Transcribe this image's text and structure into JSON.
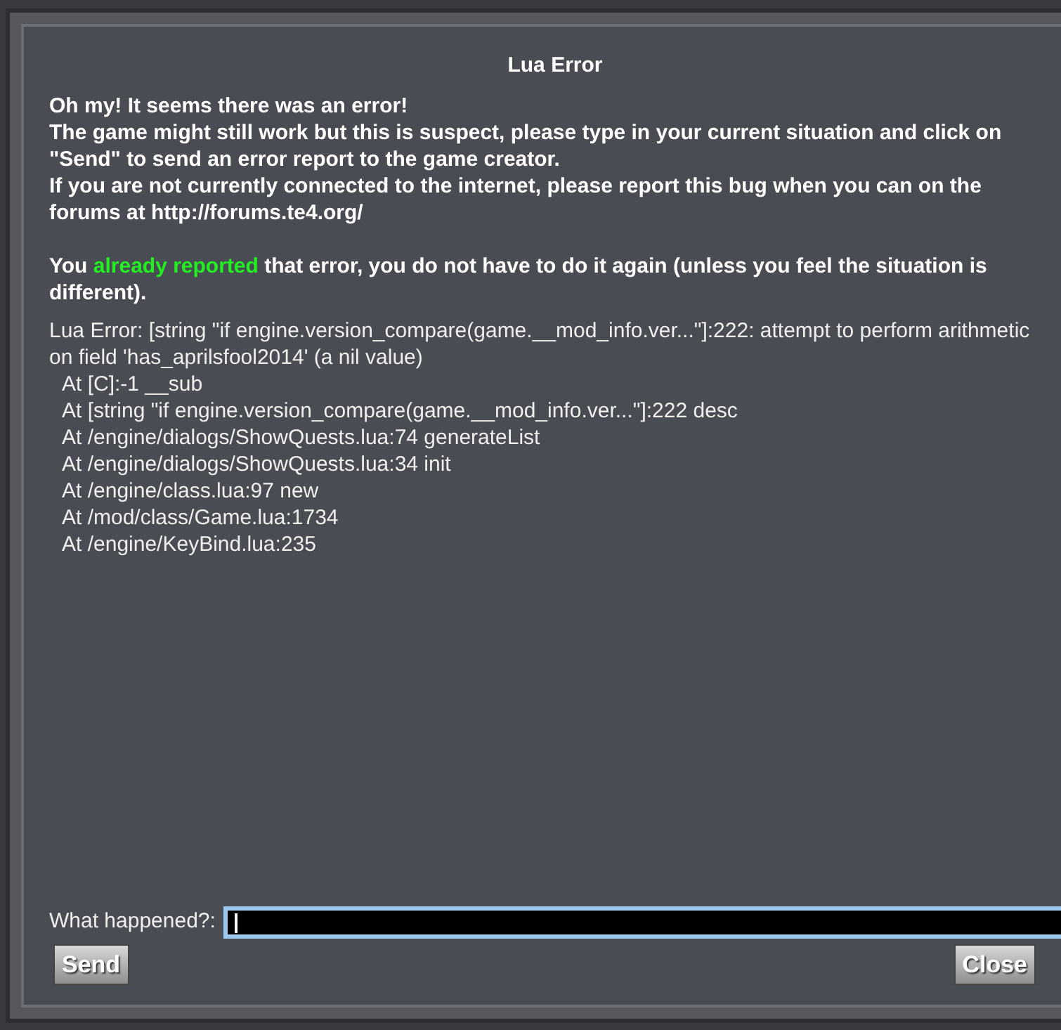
{
  "dialog": {
    "title": "Lua Error"
  },
  "message": [
    "Oh my! It seems there was an error!",
    "The game might still work but this is suspect, please type in your current situation and click on \"Send\" to send an error report to the game creator.",
    "If you are not currently connected to the internet, please report this bug when you can on the forums at http://forums.te4.org/"
  ],
  "notice": {
    "before": "You ",
    "highlight": "already reported",
    "after": " that error, you do not have to do it again (unless you feel the situation is different)."
  },
  "error": {
    "summary": "Lua Error: [string \"if engine.version_compare(game.__mod_info.ver...\"]:222: attempt to perform arithmetic on field 'has_aprilsfool2014' (a nil value)",
    "traceback": [
      "At [C]:-1 __sub",
      "At [string \"if engine.version_compare(game.__mod_info.ver...\"]:222 desc",
      "At /engine/dialogs/ShowQuests.lua:74 generateList",
      "At /engine/dialogs/ShowQuests.lua:34 init",
      "At /engine/class.lua:97 new",
      "At /mod/class/Game.lua:1734",
      "At /engine/KeyBind.lua:235"
    ]
  },
  "report_field": {
    "label": "What happened?:",
    "focused": true
  },
  "buttons": {
    "send": "Send",
    "close": "Close"
  }
}
